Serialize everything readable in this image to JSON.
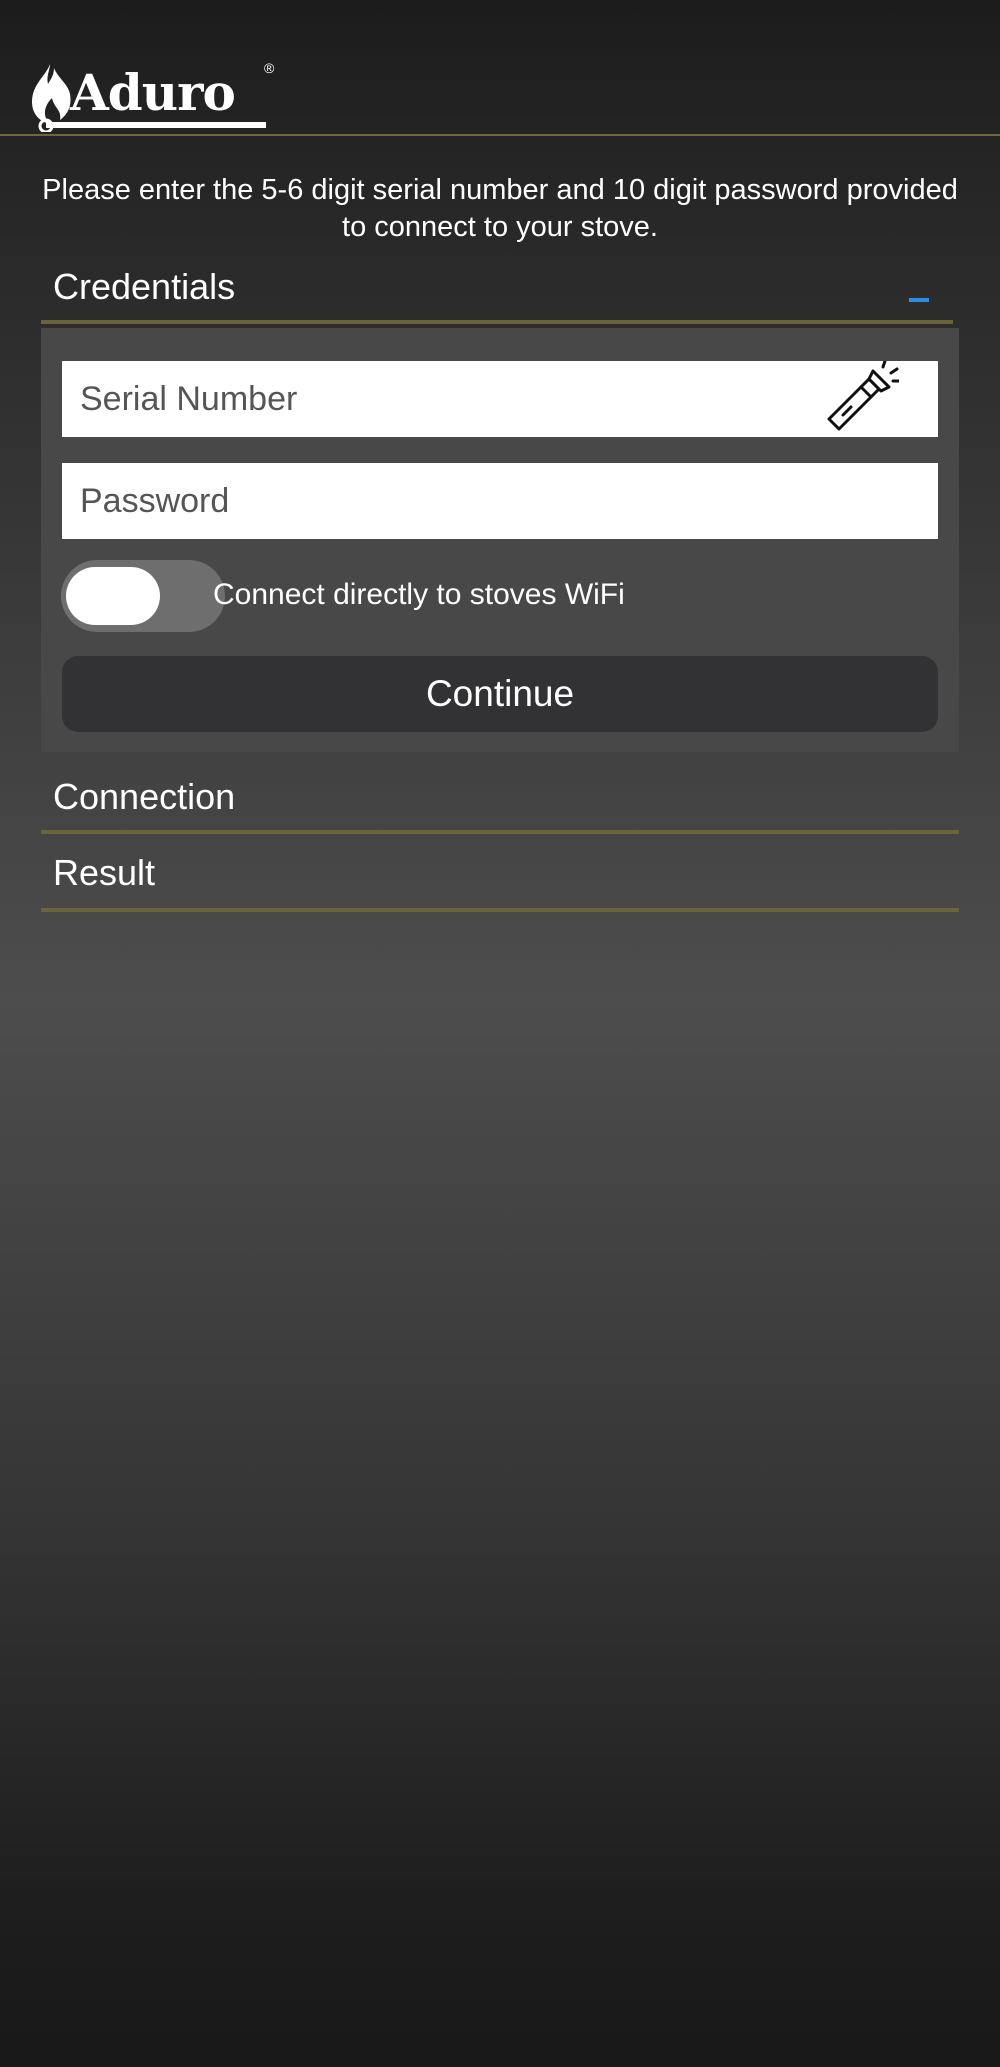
{
  "header": {
    "logo_text": "Aduro",
    "logo_reg": "®"
  },
  "intro": {
    "text": "Please enter the 5-6 digit serial number and 10 digit password provided to connect to your stove."
  },
  "sections": {
    "credentials": {
      "title": "Credentials",
      "expanded": true,
      "serial_number": {
        "placeholder": "Serial Number",
        "value": ""
      },
      "password": {
        "placeholder": "Password",
        "value": ""
      },
      "wifi_toggle": {
        "label": "Connect directly to stoves WiFi",
        "on": false
      },
      "continue_label": "Continue"
    },
    "connection": {
      "title": "Connection"
    },
    "result": {
      "title": "Result"
    }
  },
  "colors": {
    "accent_line": "#6b6439",
    "collapse_toggle": "#2d8be6",
    "panel_bg": "#484848",
    "button_bg": "#323234"
  },
  "icons": {
    "logo": "aduro-flame-logo",
    "scan": "flashlight-icon",
    "collapse": "minus-icon"
  }
}
